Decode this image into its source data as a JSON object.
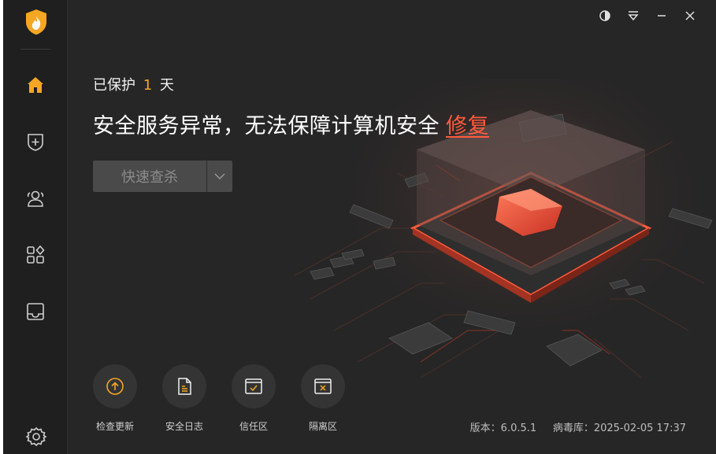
{
  "window": {
    "title_controls": {
      "theme_icon": "half-circle-icon",
      "menu_icon": "menu-dropdown-icon",
      "minimize_icon": "minimize-icon",
      "close_icon": "close-icon"
    }
  },
  "sidebar": {
    "logo_icon": "flame-shield-logo",
    "items": [
      {
        "name": "home",
        "icon": "home-icon",
        "active": true
      },
      {
        "name": "protection",
        "icon": "shield-plus-icon",
        "active": false
      },
      {
        "name": "users",
        "icon": "users-icon",
        "active": false
      },
      {
        "name": "apps",
        "icon": "apps-grid-icon",
        "active": false
      },
      {
        "name": "tray",
        "icon": "tray-box-icon",
        "active": false
      }
    ],
    "settings_icon": "gear-icon"
  },
  "main": {
    "protect_prefix": "已保护",
    "protect_days": "1",
    "protect_suffix": "天",
    "status_text": "安全服务异常，无法保障计算机安全",
    "fix_link": "修复",
    "scan_button": "快速查杀"
  },
  "tools": [
    {
      "label": "检查更新",
      "icon": "upgrade-icon"
    },
    {
      "label": "安全日志",
      "icon": "log-document-icon"
    },
    {
      "label": "信任区",
      "icon": "trust-zone-icon"
    },
    {
      "label": "隔离区",
      "icon": "quarantine-icon"
    }
  ],
  "footer": {
    "version_label": "版本：",
    "version_value": "6.0.5.1",
    "virusdb_label": "病毒库：",
    "virusdb_value": "2025-02-05 17:37"
  },
  "colors": {
    "accent_orange": "#f5a623",
    "alert_red": "#ff5a3c",
    "background": "#262626",
    "sidebar": "#1f1f1f"
  }
}
